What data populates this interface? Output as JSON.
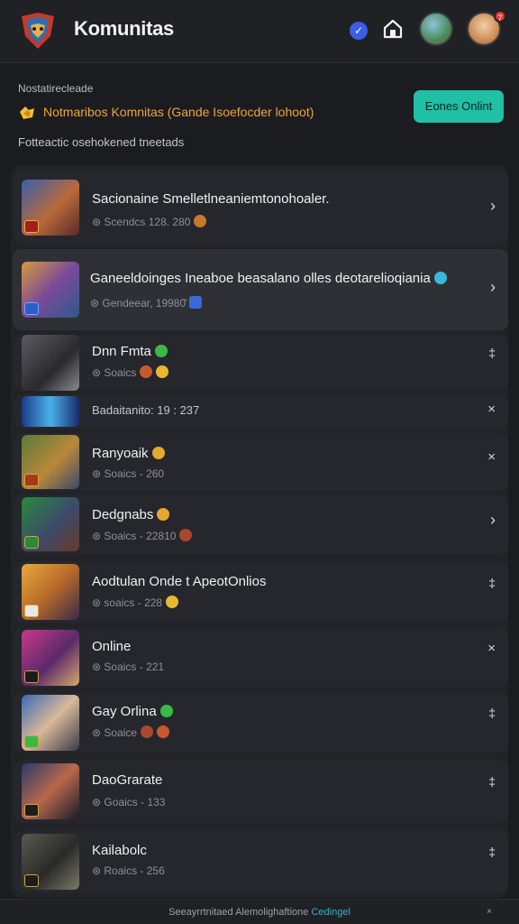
{
  "header": {
    "title": "Komunitas",
    "verified_icon": "check-badge-icon",
    "home_icon": "home-icon",
    "notification_count": "7"
  },
  "banner": {
    "section_label": "Nostatirecleade",
    "announcement": "Notmaribos Komnitas (Gande  Isoefocder lohoot)",
    "action_label": "Eones Onlint",
    "subtitle": "Fotteactic osehokened tneetads"
  },
  "rows": [
    {
      "title": "Sacionaine Smelletlneaniemtonohoaler.",
      "meta": "⊛ Scendcs 128. 280",
      "chevron": "›"
    },
    {
      "title": "Ganeeldoinges Ineaboe beasalano olles deotarelioqiania",
      "meta": "⊛ Gendeear, 19980̆",
      "chevron": "›"
    },
    {
      "title": "Dnn Fmta",
      "meta": "⊛ Soaics",
      "chevron": "‡"
    },
    {
      "title": "Badaitanito: 19 : 237",
      "meta": "",
      "chevron": "×"
    },
    {
      "title": "Ranyoaik",
      "meta": "⊛ Soaics - 260",
      "chevron": "×"
    },
    {
      "title": "Dedgnabs",
      "meta": "⊛ Soaics - 22810",
      "chevron": "›"
    },
    {
      "title": "Aodtulan Onde t ApeotOnlios",
      "meta": "⊛ soaics - 228",
      "chevron": "‡"
    },
    {
      "title": "Online",
      "meta": "⊛ Soaics - 221",
      "chevron": "×"
    },
    {
      "title": "Gay Orlina",
      "meta": "⊛ Soaice",
      "chevron": "‡"
    },
    {
      "title": "DaoGrarate",
      "meta": "⊛ Goaics - 133",
      "chevron": "‡"
    },
    {
      "title": "Kailabolc",
      "meta": "⊛ Roaics - 256",
      "chevron": "‡"
    }
  ],
  "footer": {
    "text": "Seeayrrtnitaed Alemolighaftione",
    "link": "Cedingel",
    "close": "×"
  },
  "colors": {
    "accent": "#1fc0a4",
    "highlight": "#f0a53a",
    "background": "#1b1c20"
  }
}
